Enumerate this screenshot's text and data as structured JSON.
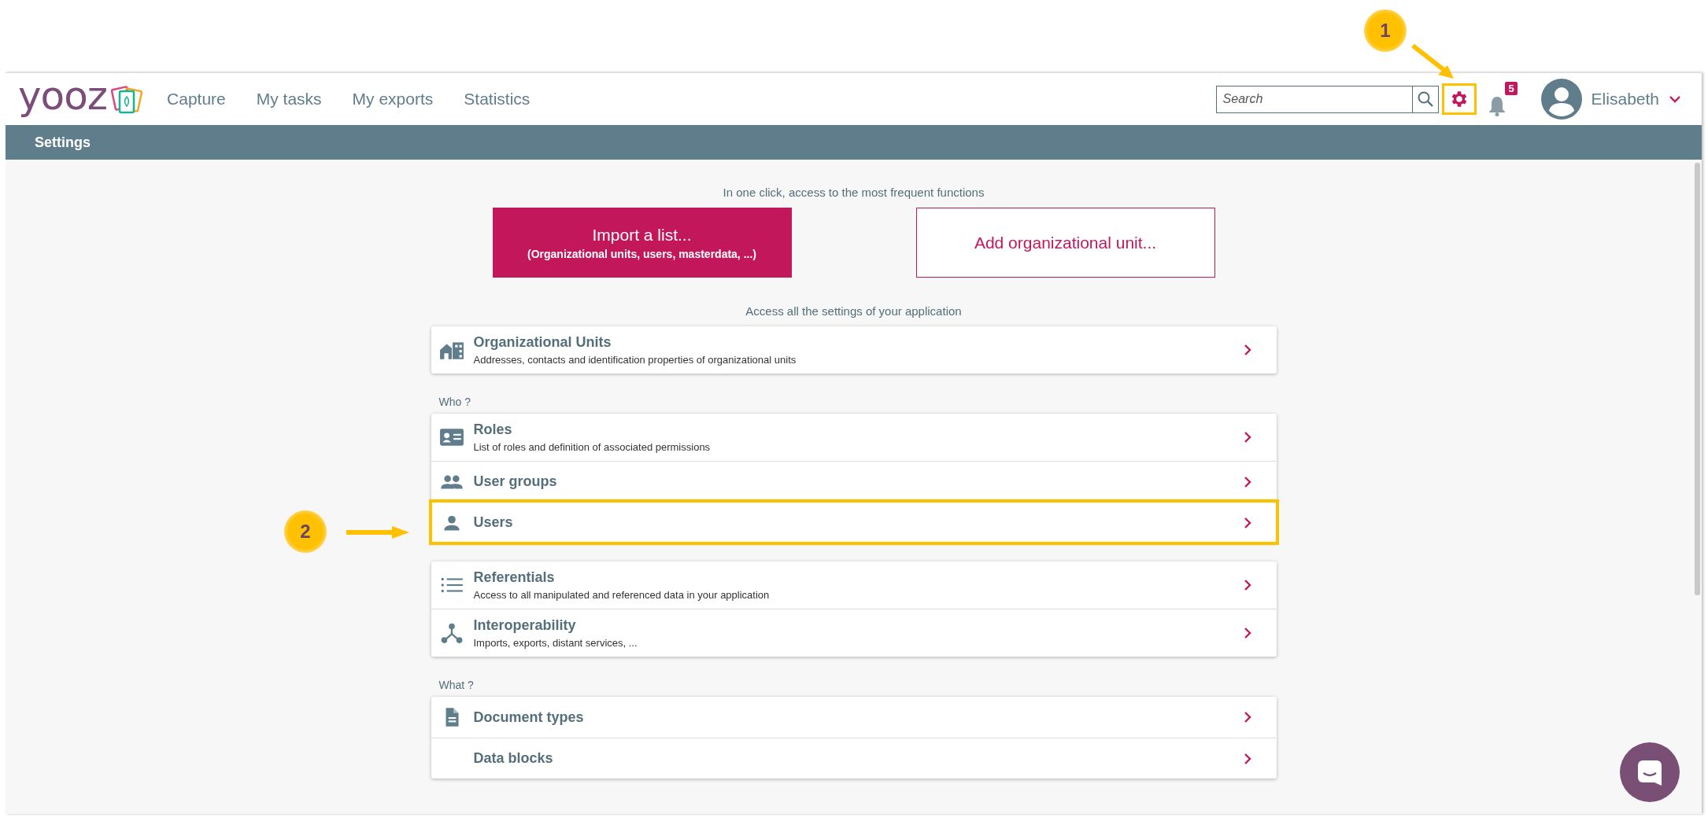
{
  "logo": "yooz",
  "nav": [
    {
      "label": "Capture"
    },
    {
      "label": "My tasks"
    },
    {
      "label": "My exports"
    },
    {
      "label": "Statistics"
    }
  ],
  "search": {
    "placeholder": "Search"
  },
  "settings_highlighted": true,
  "notifications": {
    "count": "5"
  },
  "user": {
    "name": "Elisabeth"
  },
  "page_title": "Settings",
  "intro": "In one click, access to the most frequent functions",
  "quick_actions": [
    {
      "kind": "primary",
      "title": "Import a list...",
      "subtitle": "(Organizational units, users, masterdata, ...)"
    },
    {
      "kind": "secondary",
      "title": "Add organizational unit..."
    }
  ],
  "settings_heading": "Access all the settings of your application",
  "groups": [
    {
      "items": [
        {
          "kind": "building",
          "title": "Organizational Units",
          "description": "Addresses, contacts and identification properties of organizational units",
          "highlighted": false
        }
      ]
    },
    {
      "heading": "Who ?",
      "items": [
        {
          "kind": "idcard",
          "title": "Roles",
          "description": "List of roles and definition of associated permissions",
          "highlighted": false
        },
        {
          "kind": "group",
          "title": "User groups",
          "highlighted": false
        },
        {
          "kind": "person",
          "title": "Users",
          "highlighted": true
        }
      ]
    },
    {
      "items": [
        {
          "kind": "list",
          "title": "Referentials",
          "description": "Access to all manipulated and referenced data in your application",
          "highlighted": false
        },
        {
          "kind": "network",
          "title": "Interoperability",
          "description": "Imports, exports, distant services, ...",
          "highlighted": false
        }
      ]
    },
    {
      "heading": "What ?",
      "items": [
        {
          "kind": "document",
          "title": "Document types",
          "highlighted": false
        },
        {
          "kind": "plain",
          "title": "Data blocks",
          "highlighted": false
        }
      ]
    }
  ],
  "annotations": [
    {
      "label": "1"
    },
    {
      "label": "2"
    }
  ]
}
